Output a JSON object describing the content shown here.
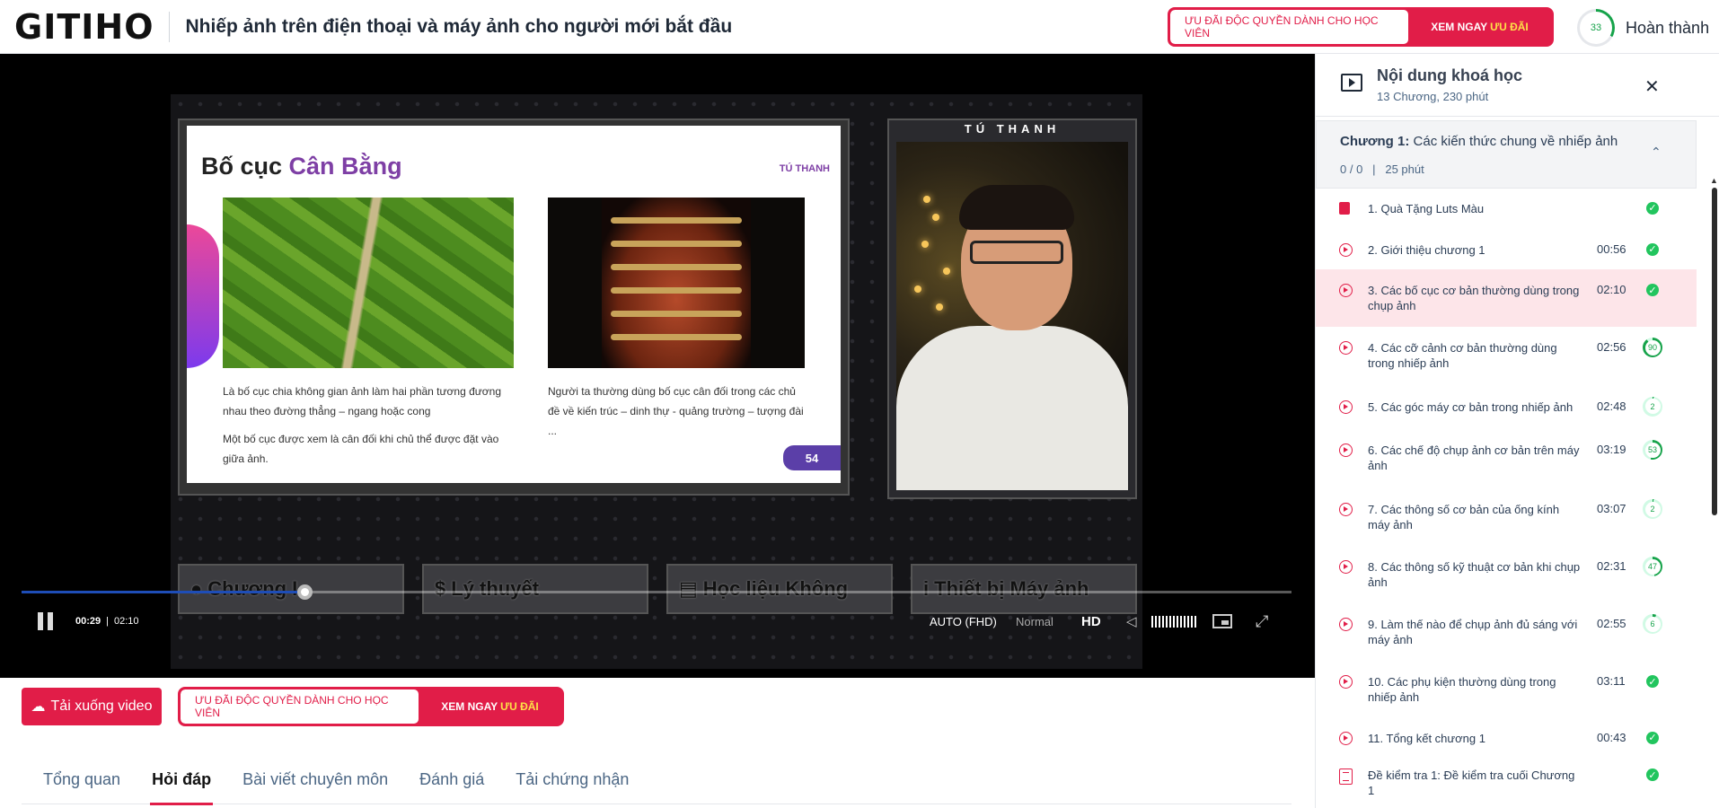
{
  "header": {
    "logo": "GITIHO",
    "course_title": "Nhiếp ảnh trên điện thoại và máy ảnh cho người mới bắt đầu",
    "promo": {
      "left_label": "ƯU ĐÃI ĐỘC QUYỀN DÀNH CHO HỌC VIÊN",
      "right_label": "XEM NGAY",
      "right_highlight": "ƯU ĐÃI"
    },
    "progress_value": "33",
    "progress_percent": 33,
    "done_label": "Hoàn thành"
  },
  "video": {
    "slide": {
      "title_plain": "Bố cục",
      "title_highlight": "Cân Bằng",
      "brand": "TÚ THANH",
      "text_left_1": "Là bố cục chia không gian ảnh làm hai phần tương đương nhau theo đường thẳng – ngang hoặc cong",
      "text_left_2": "Một bố cục được xem là cân đối khi chủ thể được đặt vào giữa ảnh.",
      "text_right": "Người ta thường dùng bố cục cân đối trong các chủ đề về kiến trúc – dinh thự - quảng trường – tượng đài ...",
      "page_number": "54"
    },
    "cam_label": "TÚ THANH",
    "chapter_buttons": [
      {
        "icon": "user-icon",
        "label": "Chương I"
      },
      {
        "icon": "dollar-icon",
        "label": "Lý thuyết"
      },
      {
        "icon": "document-icon",
        "label": "Học liệu Không"
      },
      {
        "icon": "info-icon",
        "label": "Thiết bị Máy ảnh"
      }
    ],
    "player": {
      "current_time": "00:29",
      "separator": "|",
      "duration": "02:10",
      "progress_fraction": 0.223,
      "quality_auto": "AUTO (FHD)",
      "speed": "Normal",
      "hd": "HD"
    }
  },
  "below_video": {
    "download_label": "Tải xuống video",
    "promo": {
      "left_label": "ƯU ĐÃI ĐỘC QUYỀN DÀNH CHO HỌC VIÊN",
      "right_label": "XEM NGAY",
      "right_highlight": "ƯU ĐÃI"
    },
    "tabs": [
      {
        "label": "Tổng quan",
        "active": false
      },
      {
        "label": "Hỏi đáp",
        "active": true
      },
      {
        "label": "Bài viết chuyên môn",
        "active": false
      },
      {
        "label": "Đánh giá",
        "active": false
      },
      {
        "label": "Tải chứng nhận",
        "active": false
      }
    ]
  },
  "sidebar": {
    "title": "Nội dung khoá học",
    "subtitle": "13 Chương, 230 phút",
    "close_icon": "close-icon",
    "chapter": {
      "prefix": "Chương 1:",
      "name": "Các kiến thức chung về nhiếp ảnh",
      "meta": "0 / 0   |   25 phút"
    },
    "lessons": [
      {
        "icon": "gift-icon",
        "title": "1. Quà Tặng Luts Màu",
        "duration": "",
        "status": "done"
      },
      {
        "icon": "play-icon",
        "title": "2. Giới thiệu chương 1",
        "duration": "00:56",
        "status": "done"
      },
      {
        "icon": "play-icon",
        "title": "3. Các bố cục cơ bản thường dùng trong chụp ảnh",
        "duration": "02:10",
        "status": "done",
        "active": true
      },
      {
        "icon": "play-icon",
        "title": "4. Các cỡ cảnh cơ bản thường dùng trong nhiếp ảnh",
        "duration": "02:56",
        "status": "90",
        "percent": 90
      },
      {
        "icon": "play-icon",
        "title": "5. Các góc máy cơ bản trong nhiếp ảnh",
        "duration": "02:48",
        "status": "2",
        "percent": 2
      },
      {
        "icon": "play-icon",
        "title": "6. Các chế độ chụp ảnh cơ bản trên máy ảnh",
        "duration": "03:19",
        "status": "53",
        "percent": 53
      },
      {
        "icon": "play-icon",
        "title": "7. Các thông số cơ bản của ống kính máy ảnh",
        "duration": "03:07",
        "status": "2",
        "percent": 2
      },
      {
        "icon": "play-icon",
        "title": "8. Các thông số kỹ thuật cơ bản khi chụp ảnh",
        "duration": "02:31",
        "status": "47",
        "percent": 47
      },
      {
        "icon": "play-icon",
        "title": "9. Làm thế nào để chụp ảnh đủ sáng với máy ảnh",
        "duration": "02:55",
        "status": "6",
        "percent": 6
      },
      {
        "icon": "play-icon",
        "title": "10. Các phụ kiện thường dùng trong nhiếp ảnh",
        "duration": "03:11",
        "status": "done"
      },
      {
        "icon": "play-icon",
        "title": "11. Tổng kết chương 1",
        "duration": "00:43",
        "status": "done"
      },
      {
        "icon": "quiz-icon",
        "title": "Đề kiểm tra 1: Đề kiểm tra cuối Chương 1",
        "duration": "",
        "status": "done"
      }
    ]
  },
  "colors": {
    "brand_red": "#e11d48",
    "progress_green": "#16a34a",
    "player_blue": "#1e4db7",
    "slide_purple": "#7e3fa5"
  }
}
